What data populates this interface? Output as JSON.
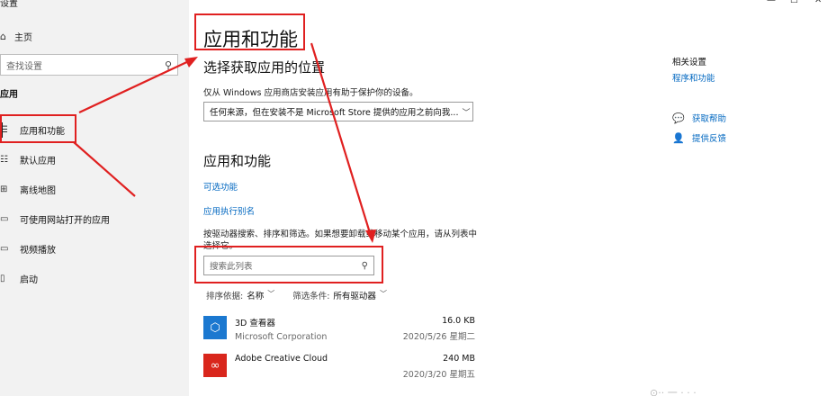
{
  "window": {
    "title": "设置"
  },
  "sidebar": {
    "home_label": "主页",
    "search_placeholder": "查找设置",
    "section_title": "应用",
    "items": [
      {
        "label": "应用和功能",
        "icon": "apps-features-icon",
        "glyph": "☰"
      },
      {
        "label": "默认应用",
        "icon": "default-apps-icon",
        "glyph": "☷"
      },
      {
        "label": "离线地图",
        "icon": "offline-maps-icon",
        "glyph": "⊞"
      },
      {
        "label": "可使用网站打开的应用",
        "icon": "apps-for-websites-icon",
        "glyph": "▭"
      },
      {
        "label": "视频播放",
        "icon": "video-playback-icon",
        "glyph": "▭"
      },
      {
        "label": "启动",
        "icon": "startup-icon",
        "glyph": "▯"
      }
    ]
  },
  "main": {
    "page_title": "应用和功能",
    "choose_section": {
      "title": "选择获取应用的位置",
      "description": "仅从 Windows 应用商店安装应用有助于保护你的设备。",
      "dropdown_value": "任何来源，但在安装不是 Microsoft Store 提供的应用之前向我..."
    },
    "apps_section": {
      "title": "应用和功能",
      "optional_features_link": "可选功能",
      "app_aliases_link": "应用执行别名",
      "help_text": "按驱动器搜索、排序和筛选。如果想要卸载或移动某个应用，请从列表中选择它。",
      "search_placeholder": "搜索此列表",
      "sort_label": "排序依据:",
      "sort_value": "名称",
      "filter_label": "筛选条件:",
      "filter_value": "所有驱动器"
    },
    "apps": [
      {
        "name": "3D 查看器",
        "publisher": "Microsoft Corporation",
        "size": "16.0 KB",
        "date": "2020/5/26 星期二",
        "icon": "3d-viewer-icon",
        "color": "#1b78d0"
      },
      {
        "name": "Adobe Creative Cloud",
        "publisher": "",
        "size": "240 MB",
        "date": "2020/3/20 星期五",
        "icon": "creative-cloud-icon",
        "color": "#d9261c"
      }
    ]
  },
  "related": {
    "title": "相关设置",
    "programs_link": "程序和功能",
    "get_help": "获取帮助",
    "give_feedback": "提供反馈"
  },
  "colors": {
    "accent": "#0067c0",
    "annotation": "#e02020",
    "sidebar_bg": "#f2f2f2"
  }
}
